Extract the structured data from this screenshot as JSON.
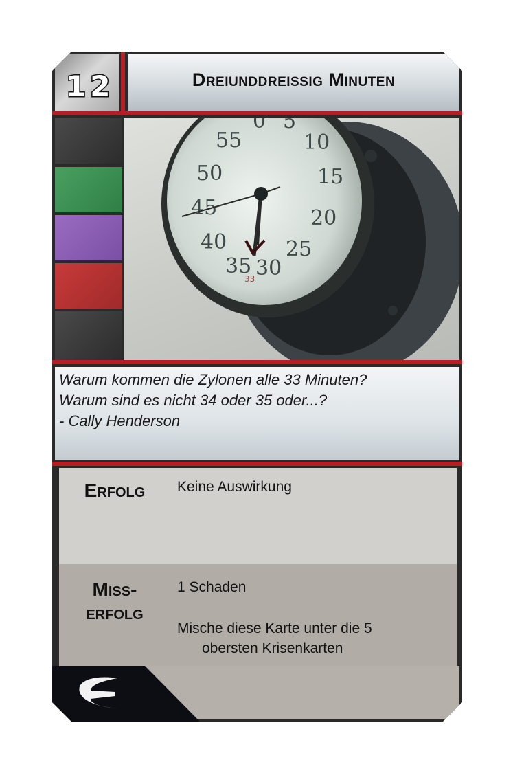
{
  "card": {
    "number": "12",
    "title": "Dreiunddreissig Minuten",
    "flavor_lines": [
      "Warum kommen die Zylonen alle 33 Minuten?",
      "Warum sind es nicht 34 oder 35 oder...?",
      "- Cally Henderson"
    ],
    "clock_numbers": [
      "0",
      "5",
      "10",
      "15",
      "20",
      "25",
      "30",
      "35",
      "40",
      "45",
      "50",
      "55"
    ],
    "clock_mark": "33",
    "success": {
      "label": "Erfolg",
      "text": "Keine Auswirkung"
    },
    "failure": {
      "label_line1": "Miss-",
      "label_line2": "erfolg",
      "text1": "1 Schaden",
      "text2_line1": "Mische diese Karte unter die 5",
      "text2_line2": "obersten Krisenkarten"
    },
    "skill_colors": [
      "#3a3a3a",
      "#3a8f52",
      "#8a5cb2",
      "#b53232",
      "#3a3a3a"
    ],
    "accent_color": "#b31f25",
    "logo_icon": "cylon-emblem-icon"
  }
}
